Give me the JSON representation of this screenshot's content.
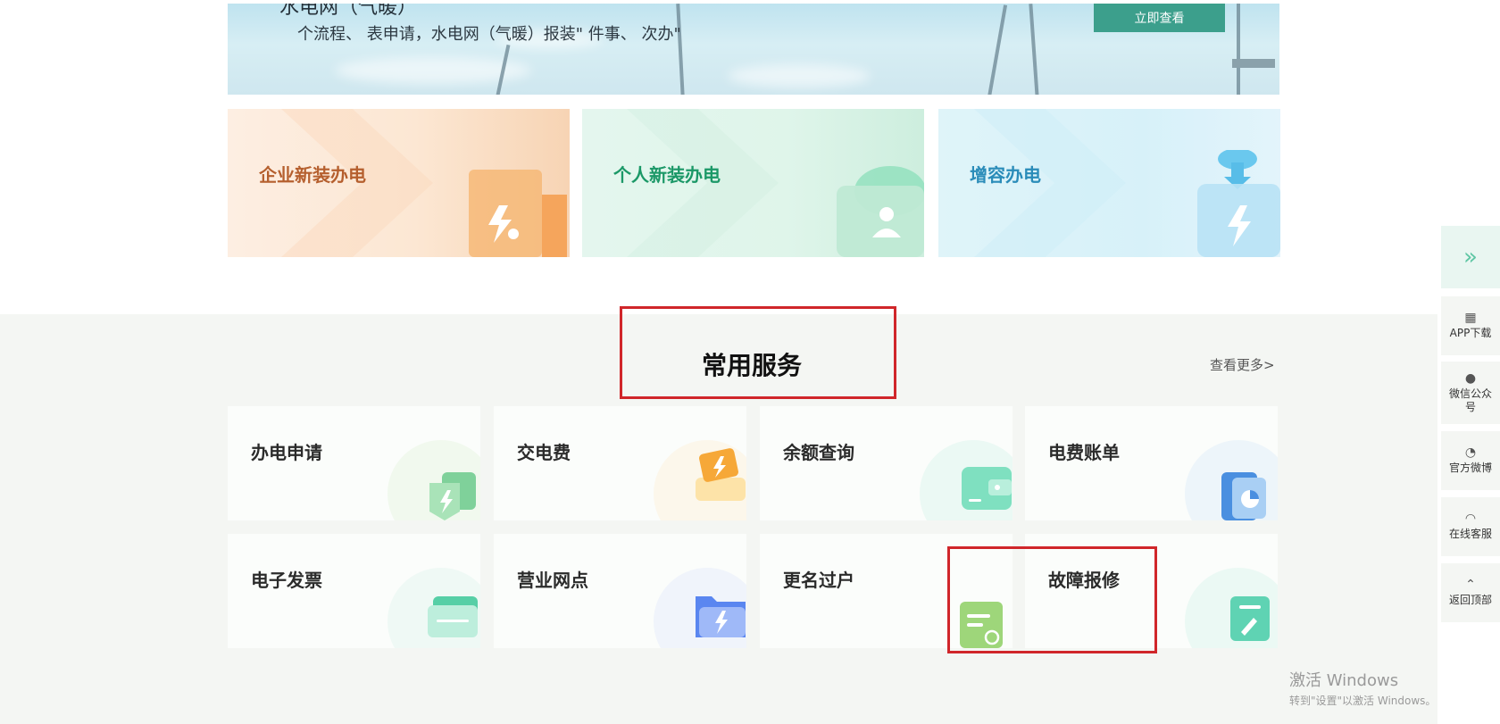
{
  "banner": {
    "title": "水电网（气暖）",
    "subtitle": "个流程、 表申请，水电网（气暖）报装\" 件事、 次办\"",
    "button_label": "立即查看"
  },
  "cards": [
    {
      "label": "企业新装办电",
      "color": "#b55f2e"
    },
    {
      "label": "个人新装办电",
      "color": "#1b9867"
    },
    {
      "label": "增容办电",
      "color": "#2a8cb9"
    }
  ],
  "services": {
    "title": "常用服务",
    "view_more": "查看更多>",
    "items": [
      {
        "label": "办电申请",
        "icon": "lightning-card-icon"
      },
      {
        "label": "交电费",
        "icon": "wallet-lightning-icon"
      },
      {
        "label": "余额查询",
        "icon": "wallet-icon"
      },
      {
        "label": "电费账单",
        "icon": "bill-chart-icon"
      },
      {
        "label": "电子发票",
        "icon": "invoice-icon"
      },
      {
        "label": "营业网点",
        "icon": "folder-lightning-icon"
      },
      {
        "label": "更名过户",
        "icon": "transfer-card-icon"
      },
      {
        "label": "故障报修",
        "icon": "repair-wrench-icon"
      }
    ]
  },
  "sidebar": {
    "items": [
      {
        "label": "",
        "icon": "double-chevron-right-icon"
      },
      {
        "label": "APP下载",
        "icon": "qr-code-icon"
      },
      {
        "label": "微信公众号",
        "icon": "wechat-icon"
      },
      {
        "label": "官方微博",
        "icon": "weibo-icon"
      },
      {
        "label": "在线客服",
        "icon": "headset-icon"
      },
      {
        "label": "返回顶部",
        "icon": "arrow-up-icon"
      }
    ]
  },
  "watermark": {
    "line1": "激活 Windows",
    "line2": "转到\"设置\"以激活 Windows。"
  }
}
